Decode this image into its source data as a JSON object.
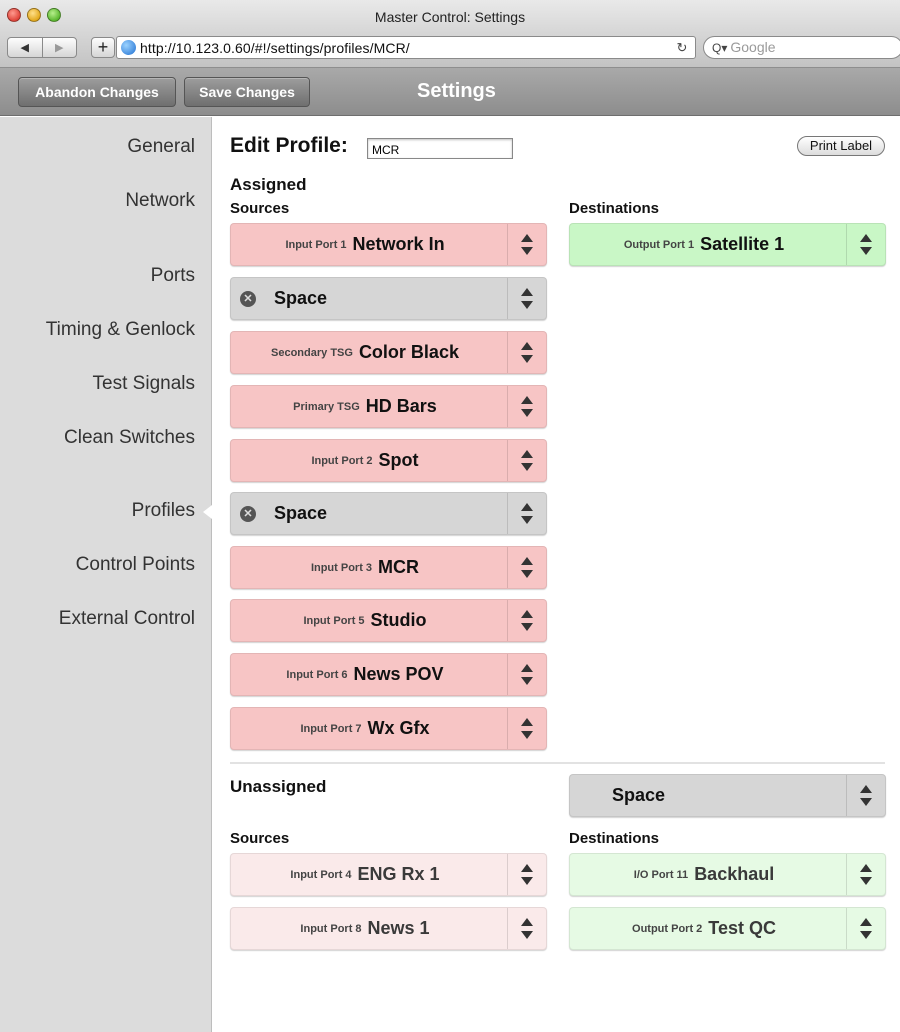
{
  "window": {
    "title": "Master Control: Settings"
  },
  "browser": {
    "back": "◀",
    "forward": "▶",
    "new_tab": "+",
    "url": "http://10.123.0.60/#!/settings/profiles/MCR/",
    "reload": "↻",
    "search_placeholder": "Google",
    "search_prefix": "Q▾"
  },
  "toolbar": {
    "abandon_label": "Abandon Changes",
    "save_label": "Save Changes",
    "title": "Settings"
  },
  "sidebar": {
    "items": [
      {
        "label": "General"
      },
      {
        "label": "Network"
      },
      {
        "label": "Ports"
      },
      {
        "label": "Timing & Genlock"
      },
      {
        "label": "Test Signals"
      },
      {
        "label": "Clean Switches"
      },
      {
        "label": "Profiles",
        "selected": true
      },
      {
        "label": "Control Points"
      },
      {
        "label": "External Control"
      }
    ]
  },
  "editor": {
    "title": "Edit Profile:",
    "profile_name": "MCR",
    "print_label": "Print Label"
  },
  "assigned": {
    "heading": "Assigned",
    "sources_heading": "Sources",
    "destinations_heading": "Destinations",
    "sources": [
      {
        "port": "Input Port 1",
        "name": "Network In",
        "kind": "source"
      },
      {
        "port": "",
        "name": "Space",
        "kind": "space"
      },
      {
        "port": "Secondary TSG",
        "name": "Color Black",
        "kind": "source"
      },
      {
        "port": "Primary TSG",
        "name": "HD Bars",
        "kind": "source"
      },
      {
        "port": "Input Port 2",
        "name": "Spot",
        "kind": "source"
      },
      {
        "port": "",
        "name": "Space",
        "kind": "space"
      },
      {
        "port": "Input Port 3",
        "name": "MCR",
        "kind": "source"
      },
      {
        "port": "Input Port 5",
        "name": "Studio",
        "kind": "source"
      },
      {
        "port": "Input Port 6",
        "name": "News POV",
        "kind": "source"
      },
      {
        "port": "Input Port 7",
        "name": "Wx Gfx",
        "kind": "source"
      }
    ],
    "destinations": [
      {
        "port": "Output Port 1",
        "name": "Satellite 1"
      }
    ]
  },
  "unassigned": {
    "heading": "Unassigned",
    "sources_heading": "Sources",
    "destinations_heading": "Destinations",
    "space_label": "Space",
    "sources": [
      {
        "port": "Input Port 4",
        "name": "ENG Rx 1"
      },
      {
        "port": "Input Port 8",
        "name": "News 1"
      }
    ],
    "destinations": [
      {
        "port": "I/O Port 11",
        "name": "Backhaul"
      },
      {
        "port": "Output Port 2",
        "name": "Test QC"
      }
    ]
  },
  "icons": {
    "remove_space": "x-circle-icon",
    "reorder": "up-down-arrows-icon",
    "globe": "globe-icon"
  },
  "colors": {
    "assigned_source": "#f7c5c5",
    "space": "#d6d6d6",
    "unassigned_source": "#faeaea",
    "assigned_destination": "#c9f7c6",
    "unassigned_destination": "#e6fae4"
  }
}
